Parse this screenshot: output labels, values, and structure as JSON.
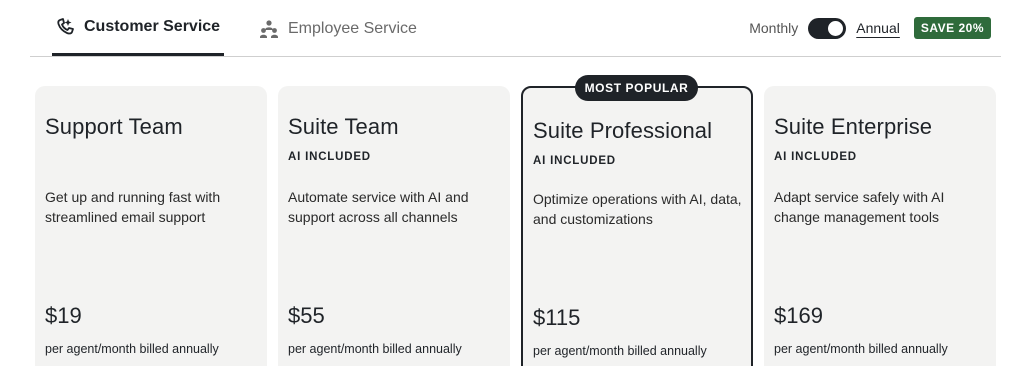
{
  "tabs": [
    {
      "label": "Customer Service",
      "icon": "customer-service-icon",
      "active": true
    },
    {
      "label": "Employee Service",
      "icon": "people-icon",
      "active": false
    }
  ],
  "billing": {
    "monthly_label": "Monthly",
    "annual_label": "Annual",
    "save_badge": "SAVE 20%",
    "annual_selected": true
  },
  "badge": {
    "most_popular": "MOST POPULAR"
  },
  "plans": [
    {
      "name": "Support Team",
      "ai": "",
      "description": "Get up and running fast with streamlined email support",
      "price": "$19",
      "billing_note": "per agent/month billed annually"
    },
    {
      "name": "Suite Team",
      "ai": "AI INCLUDED",
      "description": "Automate service with AI and support across all channels",
      "price": "$55",
      "billing_note": "per agent/month billed annually"
    },
    {
      "name": "Suite Professional",
      "ai": "AI INCLUDED",
      "description": "Optimize operations with AI, data, and customizations",
      "price": "$115",
      "billing_note": "per agent/month billed annually"
    },
    {
      "name": "Suite Enterprise",
      "ai": "AI INCLUDED",
      "description": "Adapt service safely with AI change management tools",
      "price": "$169",
      "billing_note": "per agent/month billed annually"
    }
  ],
  "colors": {
    "accent": "#1f2328",
    "save_green": "#2f6b3b",
    "card_bg": "#f3f3f2"
  }
}
